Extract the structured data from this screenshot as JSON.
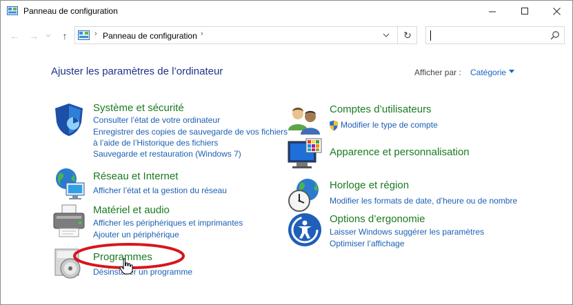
{
  "window": {
    "title": "Panneau de configuration"
  },
  "address": {
    "crumb": "Panneau de configuration",
    "sep": "›"
  },
  "main": {
    "heading": "Ajuster les paramètres de l’ordinateur",
    "view_label": "Afficher par :",
    "view_value": "Catégorie"
  },
  "categories": {
    "security": {
      "title": "Système et sécurité",
      "links": [
        "Consulter l’état de votre ordinateur",
        "Enregistrer des copies de sauvegarde de vos fichiers",
        "à l’aide de l’Historique des fichiers",
        "Sauvegarde et restauration (Windows 7)"
      ]
    },
    "network": {
      "title": "Réseau et Internet",
      "links": [
        "Afficher l’état et la gestion du réseau"
      ]
    },
    "hardware": {
      "title": "Matériel et audio",
      "links": [
        "Afficher les périphériques et imprimantes",
        "Ajouter un périphérique"
      ]
    },
    "programs": {
      "title": "Programmes",
      "links": [
        "Désinstaller un programme"
      ]
    },
    "accounts": {
      "title": "Comptes d’utilisateurs",
      "links": [
        "Modifier le type de compte"
      ]
    },
    "appearance": {
      "title": "Apparence et personnalisation"
    },
    "clock": {
      "title": "Horloge et région",
      "links": [
        "Modifier les formats de date, d’heure ou de nombre"
      ]
    },
    "ease": {
      "title": "Options d’ergonomie",
      "links": [
        "Laisser Windows suggérer les paramètres",
        "Optimiser l’affichage"
      ]
    }
  },
  "colors": {
    "heading": "#1e3287",
    "category": "#1a7a20",
    "link": "#1a5fb4",
    "annotation": "#d6161c"
  }
}
